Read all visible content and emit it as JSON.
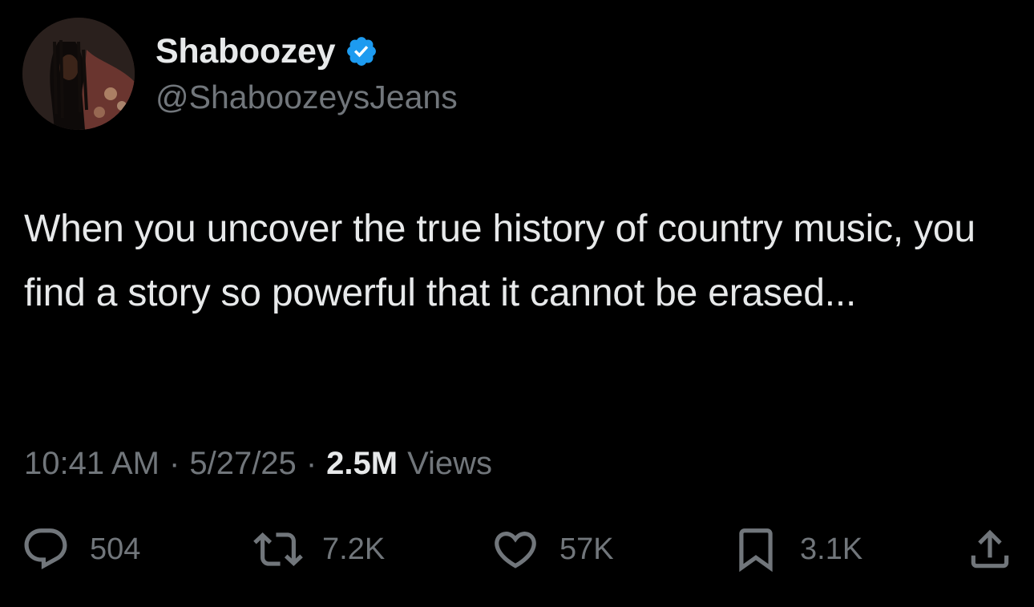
{
  "author": {
    "display_name": "Shaboozey",
    "handle": "@ShaboozeysJeans",
    "verified_icon": "verified-badge-icon",
    "verified_color": "#1d9bf0"
  },
  "tweet": {
    "text": "When you uncover the true history of country music, you find a story so powerful that it cannot be erased...",
    "time": "10:41 AM",
    "date": "5/27/25",
    "separator": "·",
    "views_count": "2.5M",
    "views_label": "Views"
  },
  "actions": {
    "replies": {
      "icon": "reply-icon",
      "count": "504"
    },
    "retweets": {
      "icon": "retweet-icon",
      "count": "7.2K"
    },
    "likes": {
      "icon": "heart-icon",
      "count": "57K"
    },
    "bookmarks": {
      "icon": "bookmark-icon",
      "count": "3.1K"
    },
    "share": {
      "icon": "share-icon"
    }
  },
  "colors": {
    "background": "#000000",
    "primary_text": "#e7e9ea",
    "secondary_text": "#71767b"
  }
}
